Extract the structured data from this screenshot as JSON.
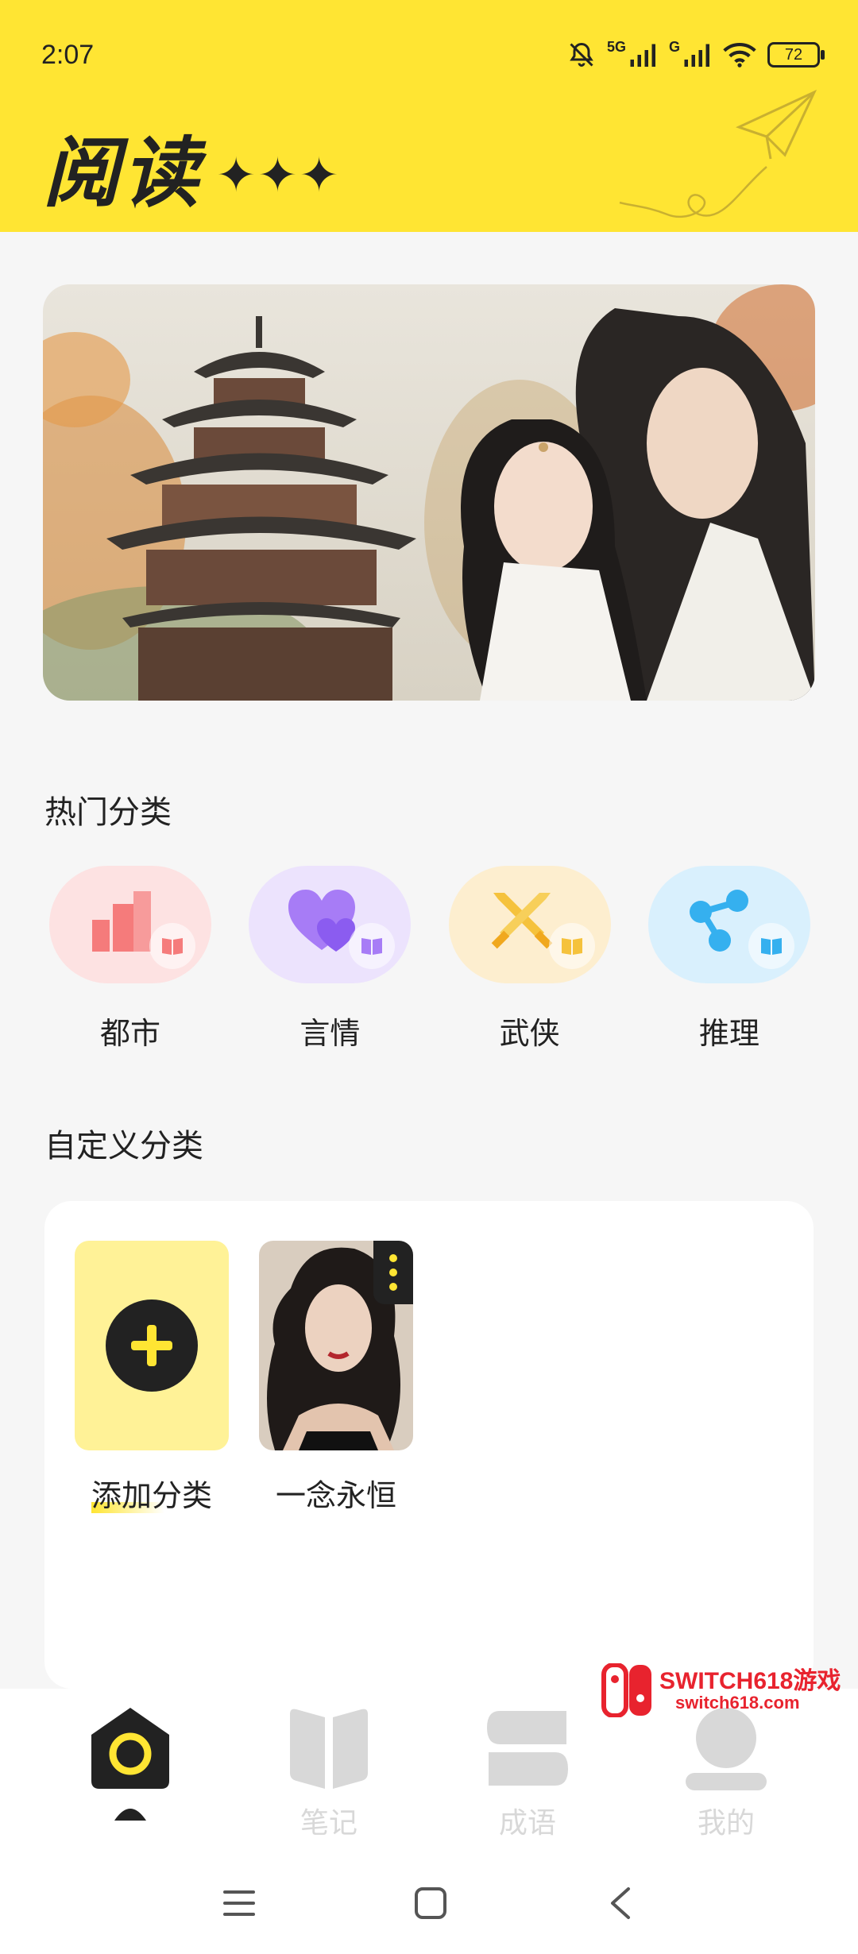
{
  "status_bar": {
    "time": "2:07",
    "signal_1": "5G",
    "signal_2": "G",
    "battery": "72"
  },
  "header": {
    "title": "阅读",
    "stars": "✦✦✦"
  },
  "hot_categories": {
    "title": "热门分类",
    "items": [
      {
        "label": "都市",
        "icon": "city-icon",
        "bg": "#fde2e2",
        "color": "#f57b7b"
      },
      {
        "label": "言情",
        "icon": "heart-icon",
        "bg": "#ece3fd",
        "color": "#a77cf6"
      },
      {
        "label": "武侠",
        "icon": "swords-icon",
        "bg": "#fdeecf",
        "color": "#f5c23c"
      },
      {
        "label": "推理",
        "icon": "network-icon",
        "bg": "#d9f0fd",
        "color": "#35b0ef"
      }
    ]
  },
  "custom_categories": {
    "title": "自定义分类",
    "add_label": "添加分类",
    "items": [
      {
        "label": "一念永恒"
      }
    ]
  },
  "tabs": [
    {
      "label": "",
      "icon": "home-icon"
    },
    {
      "label": "笔记",
      "icon": "book-icon"
    },
    {
      "label": "成语",
      "icon": "idiom-icon"
    },
    {
      "label": "我的",
      "icon": "profile-icon"
    }
  ],
  "watermark": {
    "line1": "SWITCH618游戏",
    "line2": "switch618.com"
  },
  "colors": {
    "accent": "#ffe533",
    "dark": "#222222"
  }
}
